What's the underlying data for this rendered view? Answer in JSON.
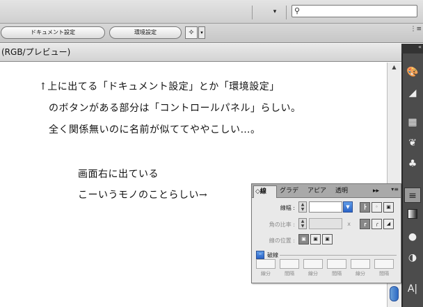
{
  "topbar": {
    "search": {
      "placeholder": "",
      "value": ""
    },
    "dropdown_arrow": "▾"
  },
  "controlbar": {
    "doc_setup_label": "ドキュメント設定",
    "prefs_label": "環境設定",
    "tool_icon": "selection-tool-icon",
    "menu_icon": "⋮≡"
  },
  "document": {
    "title": "(RGB/プレビュー)"
  },
  "handwritten": {
    "line1": "↑上に出てる「ドキュメント設定」とか「環境設定」",
    "line2": "のボタンがある部分は「コントロールパネル」らしい。",
    "line3": "全く関係無いのに名前が似ててややこしい…。",
    "line4": "画面右に出ている",
    "line5": "こーいうモノのことらしい→"
  },
  "stroke_panel": {
    "tabs": [
      {
        "label": "◇線",
        "active": true
      },
      {
        "label": "グラデ",
        "active": false
      },
      {
        "label": "アピア",
        "active": false
      },
      {
        "label": "透明",
        "active": false
      }
    ],
    "tab_arrows": "▸▸",
    "menu_icon": "▾≡",
    "weight_label": "線幅 :",
    "miter_label": "角の比率 :",
    "miter_x": "x",
    "align_label": "線の位置 :",
    "dashed_label": "破線",
    "dash_labels": [
      "線分",
      "間隔",
      "線分",
      "間隔",
      "線分",
      "間隔"
    ]
  },
  "right_tools": [
    "palette-icon",
    "gradient-icon",
    "swatch-grid-icon",
    "brush-icon",
    "symbol-icon",
    "stroke-icon",
    "layer-icon",
    "appearance-icon",
    "graphic-style-icon",
    "type-icon"
  ],
  "colors": {
    "scroll_thumb": "#2d6ac4",
    "panel_bg": "#e9e9e9",
    "dark_bar": "#4c4c4c"
  }
}
